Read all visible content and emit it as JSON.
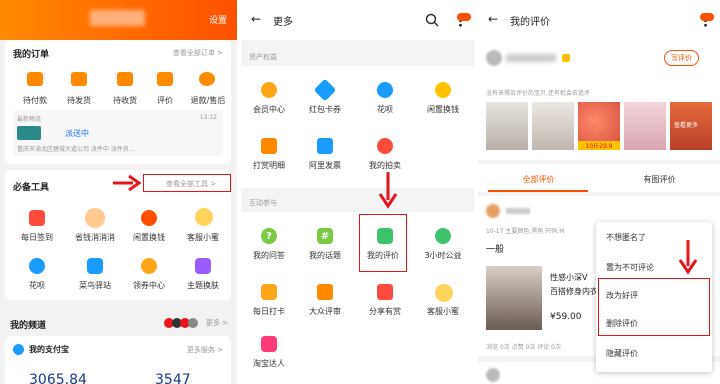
{
  "p1": {
    "settings": "设置",
    "orders": {
      "title": "我的订单",
      "all": "查看全部订单 >",
      "items": [
        "待付款",
        "待发货",
        "待收货",
        "评价",
        "退款/售后"
      ],
      "news_label": "最新物流",
      "news_time": "13:12",
      "delivery": "派送中",
      "address": "重庆市渝北区碧城大道公司 派件中 派件员..."
    },
    "tools": {
      "title": "必备工具",
      "all": "查看全部工具 >",
      "items": [
        "每日签到",
        "省钱消消消",
        "闲置换钱",
        "客服小蜜",
        "花呗",
        "菜鸟驿站",
        "领券中心",
        "主题换肤"
      ]
    },
    "channel": {
      "title": "我的频道",
      "more": "更多 >"
    },
    "alipay": {
      "title": "我的支付宝",
      "more": "更多服务 >",
      "amount1": "3065.84",
      "amount2": "3547"
    }
  },
  "p2": {
    "title": "更多",
    "section1": "资产权益",
    "grid1": [
      "会员中心",
      "红包卡券",
      "花呗",
      "闲置换钱",
      "打赏明细",
      "阿里发票",
      "我的拍卖"
    ],
    "section2": "互动参与",
    "grid2": [
      "我的问答",
      "我的话题",
      "我的评价",
      "3小时公益",
      "每日打卡",
      "大众评审",
      "分享有赏",
      "客服小蜜",
      "淘宝达人"
    ]
  },
  "p3": {
    "title": "我的评价",
    "write_btn": "写评价",
    "hint": "没有来得及评价的宝贝,还有机会去追评",
    "products": [
      {
        "tag": ""
      },
      {
        "tag": ""
      },
      {
        "tag": "10斤29.9"
      },
      {
        "tag": ""
      },
      {
        "tag": "查看更多"
      }
    ],
    "tabs": [
      "全部评价",
      "有图评价"
    ],
    "review": {
      "meta": "10-17 主要颜色:黑色 尺码:M",
      "rating": "一般",
      "item_title": "性感小深V",
      "item_sub": "百搭修身内衣",
      "price": "¥59.00",
      "stats": "浏览 0次  点赞 0次  评论 0次"
    },
    "menu": [
      "不想匿名了",
      "置为不可评论",
      "改为好评",
      "删除评价",
      "隐藏评价"
    ]
  },
  "colors": {
    "brand": "#ff5000",
    "arrow": "#e8141b",
    "highlight": "#e8141b"
  }
}
